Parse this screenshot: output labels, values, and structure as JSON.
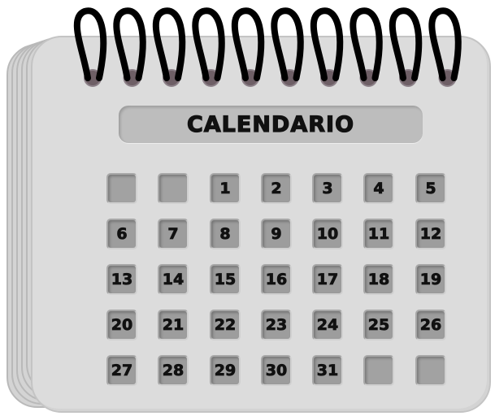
{
  "calendar": {
    "title": "CALENDARIO",
    "cells": [
      "",
      "",
      "1",
      "2",
      "3",
      "4",
      "5",
      "6",
      "7",
      "8",
      "9",
      "10",
      "11",
      "12",
      "13",
      "14",
      "15",
      "16",
      "17",
      "18",
      "19",
      "20",
      "21",
      "22",
      "23",
      "24",
      "25",
      "26",
      "27",
      "28",
      "29",
      "30",
      "31",
      "",
      ""
    ],
    "ring_count": 10
  },
  "colors": {
    "page": "#dcdcdc",
    "cell": "#9d9d9d",
    "ring": "#000000",
    "hole": "#6e5f66"
  }
}
